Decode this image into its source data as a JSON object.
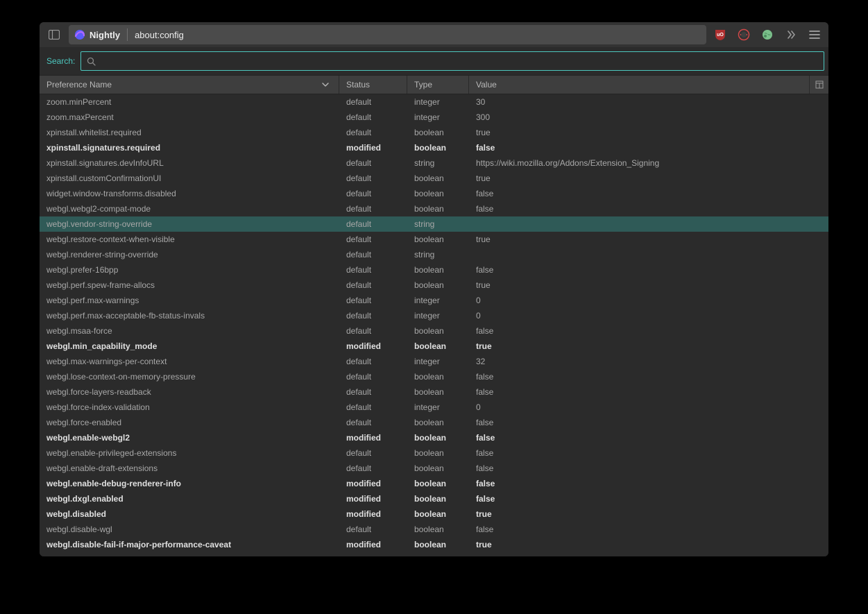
{
  "titlebar": {
    "brand": "Nightly",
    "url": "about:config",
    "ext_ublock": "uO",
    "ext_noscript": "",
    "ext_globe": ""
  },
  "search": {
    "label": "Search:",
    "value": ""
  },
  "columns": {
    "name": "Preference Name",
    "status": "Status",
    "type": "Type",
    "value": "Value"
  },
  "prefs": [
    {
      "name": "zoom.minPercent",
      "status": "default",
      "type": "integer",
      "value": "30",
      "modified": false,
      "highlighted": false
    },
    {
      "name": "zoom.maxPercent",
      "status": "default",
      "type": "integer",
      "value": "300",
      "modified": false,
      "highlighted": false
    },
    {
      "name": "xpinstall.whitelist.required",
      "status": "default",
      "type": "boolean",
      "value": "true",
      "modified": false,
      "highlighted": false
    },
    {
      "name": "xpinstall.signatures.required",
      "status": "modified",
      "type": "boolean",
      "value": "false",
      "modified": true,
      "highlighted": false
    },
    {
      "name": "xpinstall.signatures.devInfoURL",
      "status": "default",
      "type": "string",
      "value": "https://wiki.mozilla.org/Addons/Extension_Signing",
      "modified": false,
      "highlighted": false
    },
    {
      "name": "xpinstall.customConfirmationUI",
      "status": "default",
      "type": "boolean",
      "value": "true",
      "modified": false,
      "highlighted": false
    },
    {
      "name": "widget.window-transforms.disabled",
      "status": "default",
      "type": "boolean",
      "value": "false",
      "modified": false,
      "highlighted": false
    },
    {
      "name": "webgl.webgl2-compat-mode",
      "status": "default",
      "type": "boolean",
      "value": "false",
      "modified": false,
      "highlighted": false
    },
    {
      "name": "webgl.vendor-string-override",
      "status": "default",
      "type": "string",
      "value": "",
      "modified": false,
      "highlighted": true
    },
    {
      "name": "webgl.restore-context-when-visible",
      "status": "default",
      "type": "boolean",
      "value": "true",
      "modified": false,
      "highlighted": false
    },
    {
      "name": "webgl.renderer-string-override",
      "status": "default",
      "type": "string",
      "value": "",
      "modified": false,
      "highlighted": false
    },
    {
      "name": "webgl.prefer-16bpp",
      "status": "default",
      "type": "boolean",
      "value": "false",
      "modified": false,
      "highlighted": false
    },
    {
      "name": "webgl.perf.spew-frame-allocs",
      "status": "default",
      "type": "boolean",
      "value": "true",
      "modified": false,
      "highlighted": false
    },
    {
      "name": "webgl.perf.max-warnings",
      "status": "default",
      "type": "integer",
      "value": "0",
      "modified": false,
      "highlighted": false
    },
    {
      "name": "webgl.perf.max-acceptable-fb-status-invals",
      "status": "default",
      "type": "integer",
      "value": "0",
      "modified": false,
      "highlighted": false
    },
    {
      "name": "webgl.msaa-force",
      "status": "default",
      "type": "boolean",
      "value": "false",
      "modified": false,
      "highlighted": false
    },
    {
      "name": "webgl.min_capability_mode",
      "status": "modified",
      "type": "boolean",
      "value": "true",
      "modified": true,
      "highlighted": false
    },
    {
      "name": "webgl.max-warnings-per-context",
      "status": "default",
      "type": "integer",
      "value": "32",
      "modified": false,
      "highlighted": false
    },
    {
      "name": "webgl.lose-context-on-memory-pressure",
      "status": "default",
      "type": "boolean",
      "value": "false",
      "modified": false,
      "highlighted": false
    },
    {
      "name": "webgl.force-layers-readback",
      "status": "default",
      "type": "boolean",
      "value": "false",
      "modified": false,
      "highlighted": false
    },
    {
      "name": "webgl.force-index-validation",
      "status": "default",
      "type": "integer",
      "value": "0",
      "modified": false,
      "highlighted": false
    },
    {
      "name": "webgl.force-enabled",
      "status": "default",
      "type": "boolean",
      "value": "false",
      "modified": false,
      "highlighted": false
    },
    {
      "name": "webgl.enable-webgl2",
      "status": "modified",
      "type": "boolean",
      "value": "false",
      "modified": true,
      "highlighted": false
    },
    {
      "name": "webgl.enable-privileged-extensions",
      "status": "default",
      "type": "boolean",
      "value": "false",
      "modified": false,
      "highlighted": false
    },
    {
      "name": "webgl.enable-draft-extensions",
      "status": "default",
      "type": "boolean",
      "value": "false",
      "modified": false,
      "highlighted": false
    },
    {
      "name": "webgl.enable-debug-renderer-info",
      "status": "modified",
      "type": "boolean",
      "value": "false",
      "modified": true,
      "highlighted": false
    },
    {
      "name": "webgl.dxgl.enabled",
      "status": "modified",
      "type": "boolean",
      "value": "false",
      "modified": true,
      "highlighted": false
    },
    {
      "name": "webgl.disabled",
      "status": "modified",
      "type": "boolean",
      "value": "true",
      "modified": true,
      "highlighted": false
    },
    {
      "name": "webgl.disable-wgl",
      "status": "default",
      "type": "boolean",
      "value": "false",
      "modified": false,
      "highlighted": false
    },
    {
      "name": "webgl.disable-fail-if-major-performance-caveat",
      "status": "modified",
      "type": "boolean",
      "value": "true",
      "modified": true,
      "highlighted": false
    }
  ]
}
